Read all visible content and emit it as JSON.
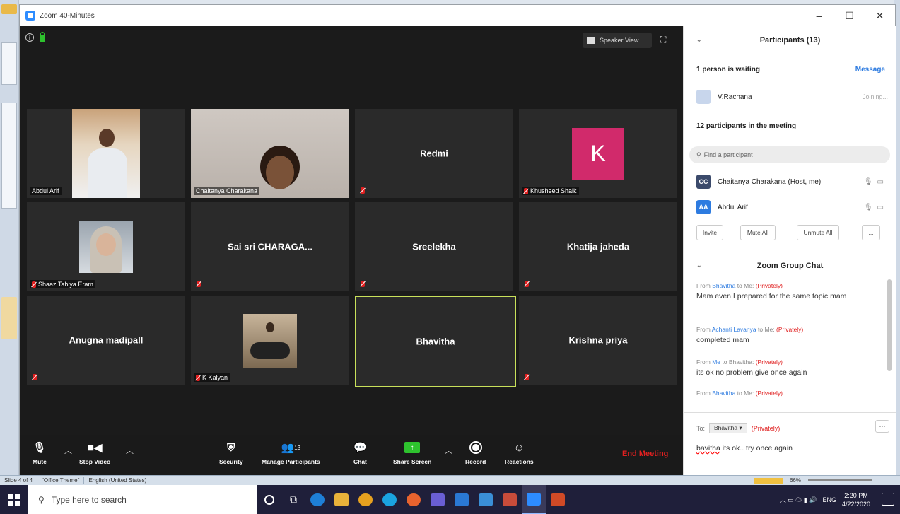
{
  "window": {
    "title": "Zoom 40-Minutes",
    "minimize": "–",
    "maximize": "☐",
    "close": "✕"
  },
  "video": {
    "speaker_view_label": "Speaker View"
  },
  "tiles": [
    {
      "id": "abdul",
      "label": "Abdul Arif",
      "type": "photo",
      "muted": false
    },
    {
      "id": "chaitanya",
      "label": "Chaitanya Charakana",
      "type": "photo",
      "muted": false
    },
    {
      "id": "redmi",
      "name": "Redmi",
      "type": "name",
      "muted": true
    },
    {
      "id": "khusheed",
      "label": "Khusheed Shaik",
      "type": "avatar",
      "avatar_letter": "K",
      "avatar_color": "#d12a6b",
      "muted": true
    },
    {
      "id": "shaaz",
      "label": "Shaaz Tahiya Eram",
      "type": "photo",
      "muted": true
    },
    {
      "id": "saisri",
      "name": "Sai sri CHARAGA...",
      "type": "name",
      "muted": true
    },
    {
      "id": "sreelekha",
      "name": "Sreelekha",
      "type": "name",
      "muted": true
    },
    {
      "id": "khatija",
      "name": "Khatija jaheda",
      "type": "name",
      "muted": true
    },
    {
      "id": "anugna",
      "name": "Anugna madipall",
      "type": "name",
      "muted": true
    },
    {
      "id": "kalyan",
      "label": "K Kalyan",
      "type": "photo",
      "muted": true
    },
    {
      "id": "bhavitha",
      "name": "Bhavitha",
      "type": "name",
      "muted": false,
      "active": true
    },
    {
      "id": "krishna",
      "name": "Krishna priya",
      "type": "name",
      "muted": true
    }
  ],
  "toolbar": {
    "mute": "Mute",
    "stop_video": "Stop Video",
    "security": "Security",
    "manage_participants": "Manage Participants",
    "participant_count": "13",
    "chat": "Chat",
    "share_screen": "Share Screen",
    "record": "Record",
    "reactions": "Reactions",
    "end_meeting": "End Meeting"
  },
  "participants": {
    "header": "Participants (13)",
    "waiting_label": "1 person is waiting",
    "message_link": "Message",
    "waiting_user": {
      "name": "V.Rachana",
      "status": "Joining..."
    },
    "in_meeting_label": "12 participants in the meeting",
    "search_placeholder": "Find a participant",
    "list": [
      {
        "initials": "CC",
        "name": "Chaitanya Charakana (Host, me)",
        "color": "#3b4a6b"
      },
      {
        "initials": "AA",
        "name": "Abdul Arif",
        "color": "#2d7be0"
      }
    ],
    "buttons": {
      "invite": "Invite",
      "mute_all": "Mute All",
      "unmute_all": "Unmute All",
      "more": "..."
    }
  },
  "chat": {
    "header": "Zoom Group Chat",
    "messages": [
      {
        "from": "Bhavitha",
        "to": "Me",
        "privately": "(Privately)",
        "text": "Mam even I prepared for the same topic mam"
      },
      {
        "from": "Achanti Lavanya",
        "to": "Me",
        "privately": "(Privately)",
        "text": "completed mam"
      },
      {
        "from": "Me",
        "to": "Bhavitha",
        "privately": "(Privately)",
        "text": "its ok no problem give once again"
      },
      {
        "from": "Bhavitha",
        "to": "Me",
        "privately": "(Privately)",
        "text": ""
      }
    ],
    "from_word": "From",
    "to_word": "to",
    "to_label": "To:",
    "to_select": "Bhavitha ▾",
    "to_privately": "(Privately)",
    "input_word1": "bavitha",
    "input_rest": " its ok.. try once again",
    "more": "···"
  },
  "statusbar": {
    "slide": "Slide 4 of 4",
    "theme": "\"Office Theme\"",
    "language": "English (United States)",
    "zoom": "66%"
  },
  "taskbar": {
    "search_placeholder": "Type here to search",
    "time": "2:20 PM",
    "date": "4/22/2020",
    "lang": "ENG",
    "apps": [
      {
        "icon": "cortana-icon",
        "color": "#1f1f3a"
      },
      {
        "icon": "task-view-icon",
        "color": "#1f1f3a"
      },
      {
        "icon": "edge-icon",
        "color": "#1e7fd6"
      },
      {
        "icon": "file-explorer-icon",
        "color": "#e8b23a"
      },
      {
        "icon": "chrome-icon",
        "color": "#e6a11f"
      },
      {
        "icon": "skype-icon",
        "color": "#1aa3e0"
      },
      {
        "icon": "firefox-icon",
        "color": "#e8632e"
      },
      {
        "icon": "paint-icon",
        "color": "#6a5fd4"
      },
      {
        "icon": "mail-icon",
        "color": "#2a78d4"
      },
      {
        "icon": "store-icon",
        "color": "#3a8fd6"
      },
      {
        "icon": "app-icon",
        "color": "#c84c3a"
      },
      {
        "icon": "zoom-icon",
        "color": "#2d8cff"
      },
      {
        "icon": "powerpoint-icon",
        "color": "#d04a26"
      }
    ]
  }
}
